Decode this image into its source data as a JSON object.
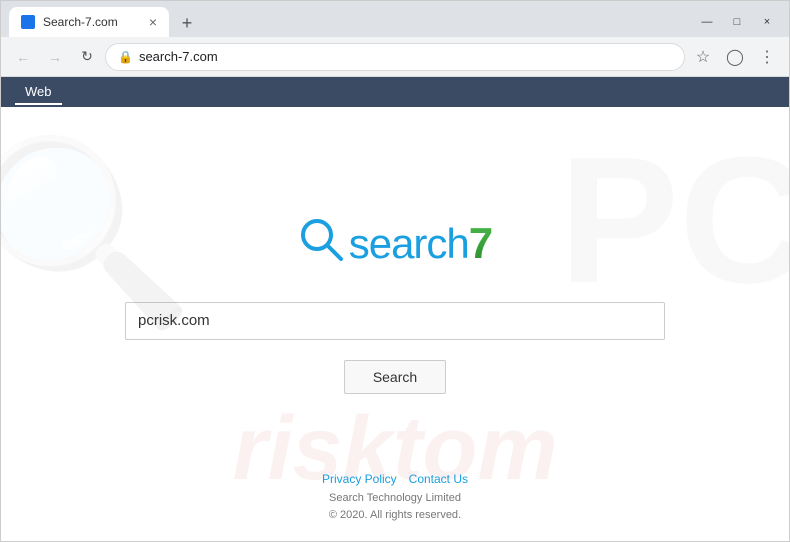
{
  "browser": {
    "tab_title": "Search-7.com",
    "tab_close": "×",
    "tab_new": "+",
    "window_minimize": "—",
    "window_maximize": "□",
    "window_close": "×",
    "address": "search-7.com",
    "web_nav_label": "Web"
  },
  "logo": {
    "text": "search",
    "number": "7"
  },
  "search": {
    "input_value": "pcrisk.com",
    "button_label": "Search"
  },
  "footer": {
    "privacy_label": "Privacy Policy",
    "contact_label": "Contact Us",
    "company": "Search Technology Limited",
    "copyright": "© 2020. All rights reserved."
  },
  "watermark": {
    "bottom_text": "risktom"
  },
  "colors": {
    "accent_blue": "#1a9fe0",
    "accent_green": "#3aaa35",
    "nav_bar_bg": "#3c4b64"
  }
}
